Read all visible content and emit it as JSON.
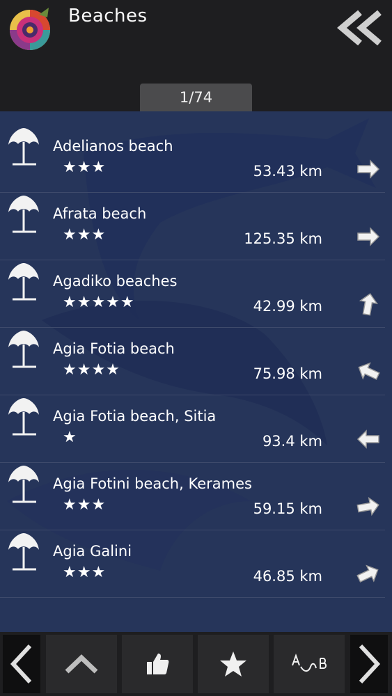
{
  "header": {
    "title": "Beaches",
    "counter": "1/74"
  },
  "beaches": [
    {
      "name": "Adelianos beach",
      "stars": 3,
      "stars_text": "★★★",
      "distance": "53.43 km",
      "direction_deg": 0
    },
    {
      "name": "Afrata beach",
      "stars": 3,
      "stars_text": "★★★",
      "distance": "125.35 km",
      "direction_deg": 0
    },
    {
      "name": "Agadiko beaches",
      "stars": 5,
      "stars_text": "★★★★★",
      "distance": "42.99 km",
      "direction_deg": -80
    },
    {
      "name": "Agia Fotia beach",
      "stars": 4,
      "stars_text": "★★★★",
      "distance": "75.98 km",
      "direction_deg": 205
    },
    {
      "name": "Agia Fotia beach, Sitia",
      "stars": 1,
      "stars_text": "★",
      "distance": "93.4 km",
      "direction_deg": 180
    },
    {
      "name": "Agia Fotini beach, Kerames",
      "stars": 3,
      "stars_text": "★★★",
      "distance": "59.15 km",
      "direction_deg": -10
    },
    {
      "name": "Agia Galini",
      "stars": 3,
      "stars_text": "★★★",
      "distance": "46.85 km",
      "direction_deg": -25
    }
  ],
  "footer": {
    "buttons": [
      "prev",
      "sort-up",
      "like",
      "favorites",
      "alphabetical",
      "next"
    ]
  },
  "colors": {
    "list_background": "#26355a",
    "header_background": "#1e1e20",
    "counter_tab": "#4b4b4d",
    "text": "#ffffff"
  }
}
